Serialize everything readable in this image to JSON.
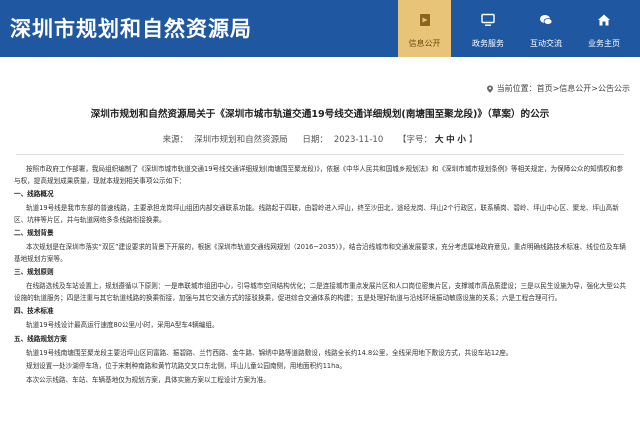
{
  "header": {
    "site_title": "深圳市规划和自然资源局",
    "nav": [
      {
        "label": "信息公开",
        "icon": "info-disclosure-icon",
        "active": true
      },
      {
        "label": "政务服务",
        "icon": "monitor-icon",
        "active": false
      },
      {
        "label": "互动交流",
        "icon": "chat-icon",
        "active": false
      },
      {
        "label": "业务主页",
        "icon": "home-icon",
        "active": false
      }
    ]
  },
  "breadcrumb": {
    "prefix": "当前位置：",
    "items": [
      "首页",
      "信息公开",
      "公告公示"
    ],
    "separator": " > "
  },
  "article": {
    "title": "深圳市规划和自然资源局关于《深圳市城市轨道交通19号线交通详细规划(南塘围至聚龙段)》（草案）的公示",
    "source_label": "来源：",
    "source": "深圳市规划和自然资源局",
    "date_label": "日期：",
    "date": "2023-11-10",
    "font_label": "【字号：",
    "font_large": "大",
    "font_medium": "中",
    "font_small": "小",
    "font_close": "】",
    "intro": "按照市政府工作部署，我局组织编制了《深圳市城市轨道交通19号线交通详细规划(南塘围至聚龙段)》，依据《中华人民共和国城乡规划法》和《深圳市城市规划条例》等相关规定，为保障公众的知情权和参与权，提高规划成果质量，现就本规划相关事项公示如下：",
    "sections": [
      {
        "heading": "一、线路概况",
        "text": "轨道19号线是我市东部的普速线路，主要承担龙岗坪山组团内部交通联系功能。线路起于四联，由碧岭进入坪山，终至沙田北，途经龙岗、坪山2个行政区，联系横岗、碧岭、坪山中心区、聚龙、坪山高新区、坑梓等片区，并与轨道网络多条线路衔接换乘。"
      },
      {
        "heading": "二、规划背景",
        "text": "本次规划是在深圳市落实“双区”建设要求的背景下开展的，根据《深圳市轨道交通线网规划（2016~2035）》，结合沿线城市和交通发展要求，充分考虑属地政府意见，重点明确线路技术标准、线位位及车辆基地规划方案等。"
      },
      {
        "heading": "三、规划原则",
        "text": "在线路选线及车站设置上，规划遵循以下原则：一是串联城市组团中心，引导城市空间结构优化；二是连接城市重点发展片区和人口岗位密集片区，支撑城市高品质建设；三是以民生设施为导，强化大型公共设施的轨道服务；四是注重与其它轨道线路的换乘衔接，加强与其它交通方式的接驳换乘，促进综合交通体系的构建；五是处理好轨道与沿线环境振动敏感设施的关系；六是工程合理可行。"
      },
      {
        "heading": "四、技术标准",
        "text": "轨道19号线设计最高运行速度80公里/小时，采用A型车4辆编组。"
      },
      {
        "heading": "五、线路规划方案",
        "text": "轨道19号线南塘围至聚龙段主要沿坪山区同富路、振碧路、兰竹西路、金牛路、锦绣中路等道路敷设，线路全长约14.8公里，全线采用地下敷设方式，共设车站12座。"
      }
    ],
    "extra_lines": [
      "规划设置一处沙湖停车场，位于宋荆种南路和黄竹坑路交叉口东北侧，坪山儿童公园南侧，用地面积约11ha。",
      "本次公示线路、车站、车辆基地仅为规划方案，具体实施方案以工程设计方案为准。"
    ]
  },
  "colors": {
    "header_bg": "#1f58a1",
    "active_nav_bg": "#e7c478"
  }
}
